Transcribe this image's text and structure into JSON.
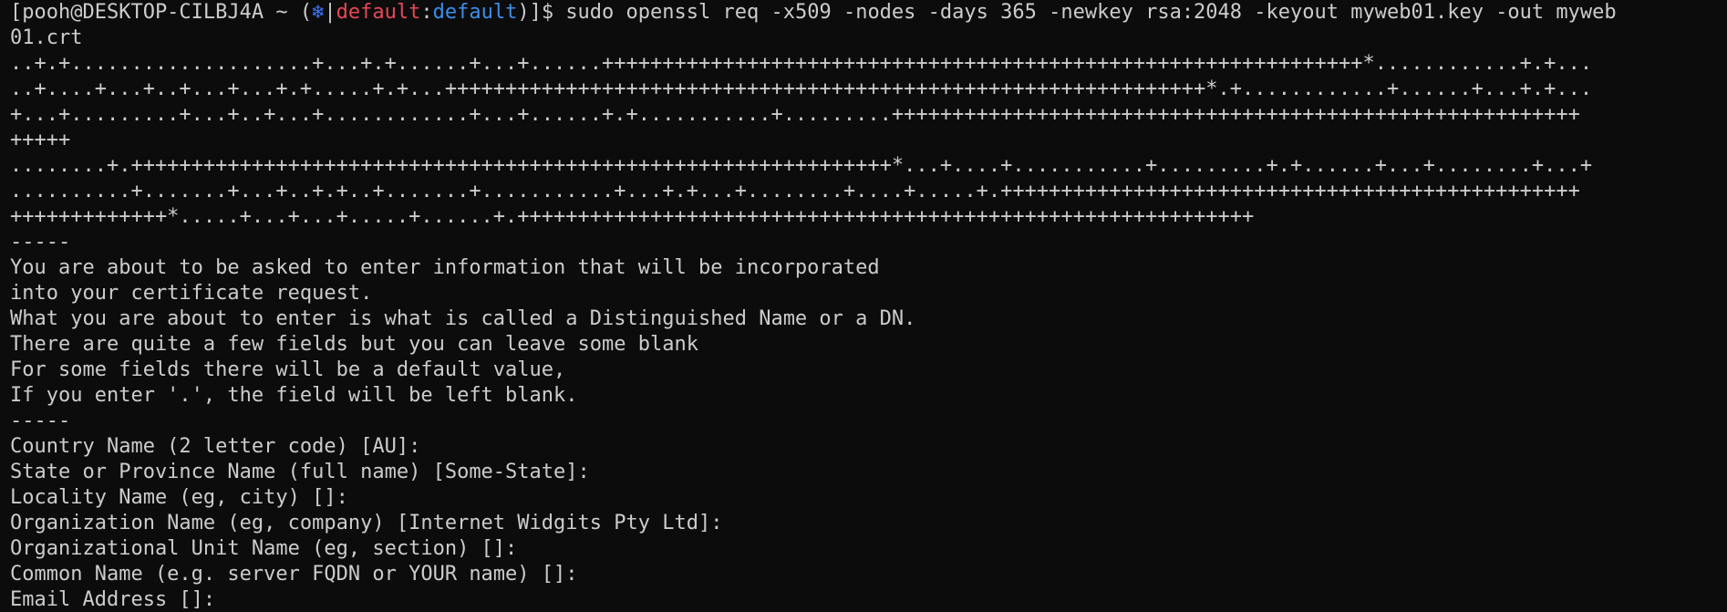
{
  "terminal": {
    "prompt": {
      "open": "[pooh@DESKTOP-CILBJ4A ~ (",
      "context_icon": "❄",
      "context_sep": "|",
      "context_name": "default",
      "context_colon": ":",
      "context_namespace": "default",
      "close": ")]$ ",
      "command": "sudo openssl req -x509 -nodes -days 365 -newkey rsa:2048 -keyout myweb01.key -out myweb"
    },
    "lines": [
      "01.crt",
      "..+.+....................+...+.+......+...+......+++++++++++++++++++++++++++++++++++++++++++++++++++++++++++++++*............+.+...",
      "..+....+...+..+...+...+.+.....+.+...+++++++++++++++++++++++++++++++++++++++++++++++++++++++++++++++*.+............+......+...+.+...",
      "+...+.........+...+..+...+............+...+......+.+...........+.........+++++++++++++++++++++++++++++++++++++++++++++++++++++++++",
      "+++++",
      "........+.+++++++++++++++++++++++++++++++++++++++++++++++++++++++++++++++*...+....+...........+.........+.+......+...+........+...+",
      "..........+.......+...+..+.+..+.......+...........+...+.+...+........+....+.....+.++++++++++++++++++++++++++++++++++++++++++++++++",
      "+++++++++++++*.....+...+...+.....+......+.+++++++++++++++++++++++++++++++++++++++++++++++++++++++++++++",
      "-----",
      "You are about to be asked to enter information that will be incorporated",
      "into your certificate request.",
      "What you are about to enter is what is called a Distinguished Name or a DN.",
      "There are quite a few fields but you can leave some blank",
      "For some fields there will be a default value,",
      "If you enter '.', the field will be left blank.",
      "-----",
      "Country Name (2 letter code) [AU]:",
      "State or Province Name (full name) [Some-State]:",
      "Locality Name (eg, city) []:",
      "Organization Name (eg, company) [Internet Widgits Pty Ltd]:",
      "Organizational Unit Name (eg, section) []:",
      "Common Name (e.g. server FQDN or YOUR name) []:",
      "Email Address []:"
    ]
  },
  "colors": {
    "background": "#0c0c0c",
    "foreground": "#cccccc",
    "context_name": "#e74856",
    "context_namespace": "#3b8eea",
    "context_icon": "#3b78ff"
  }
}
